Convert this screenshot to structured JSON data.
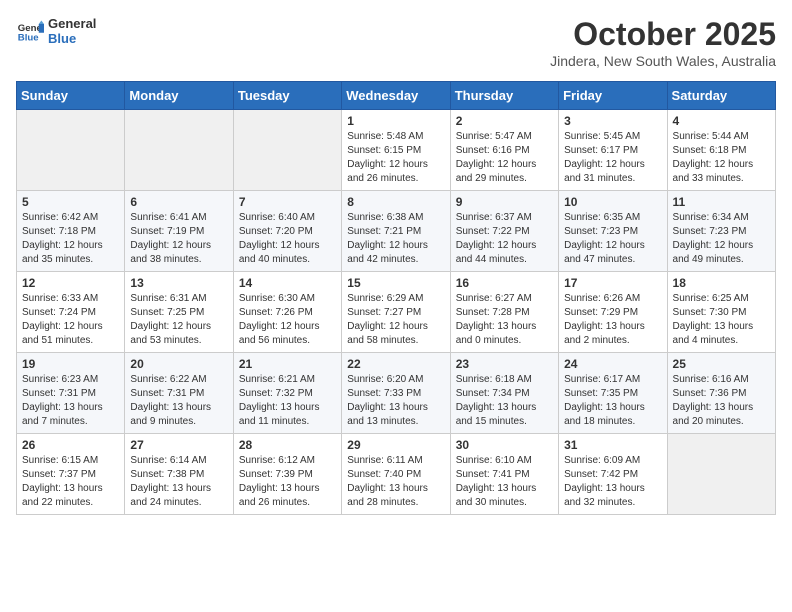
{
  "logo": {
    "line1": "General",
    "line2": "Blue"
  },
  "title": "October 2025",
  "location": "Jindera, New South Wales, Australia",
  "days_of_week": [
    "Sunday",
    "Monday",
    "Tuesday",
    "Wednesday",
    "Thursday",
    "Friday",
    "Saturday"
  ],
  "weeks": [
    [
      {
        "day": "",
        "info": ""
      },
      {
        "day": "",
        "info": ""
      },
      {
        "day": "",
        "info": ""
      },
      {
        "day": "1",
        "info": "Sunrise: 5:48 AM\nSunset: 6:15 PM\nDaylight: 12 hours\nand 26 minutes."
      },
      {
        "day": "2",
        "info": "Sunrise: 5:47 AM\nSunset: 6:16 PM\nDaylight: 12 hours\nand 29 minutes."
      },
      {
        "day": "3",
        "info": "Sunrise: 5:45 AM\nSunset: 6:17 PM\nDaylight: 12 hours\nand 31 minutes."
      },
      {
        "day": "4",
        "info": "Sunrise: 5:44 AM\nSunset: 6:18 PM\nDaylight: 12 hours\nand 33 minutes."
      }
    ],
    [
      {
        "day": "5",
        "info": "Sunrise: 6:42 AM\nSunset: 7:18 PM\nDaylight: 12 hours\nand 35 minutes."
      },
      {
        "day": "6",
        "info": "Sunrise: 6:41 AM\nSunset: 7:19 PM\nDaylight: 12 hours\nand 38 minutes."
      },
      {
        "day": "7",
        "info": "Sunrise: 6:40 AM\nSunset: 7:20 PM\nDaylight: 12 hours\nand 40 minutes."
      },
      {
        "day": "8",
        "info": "Sunrise: 6:38 AM\nSunset: 7:21 PM\nDaylight: 12 hours\nand 42 minutes."
      },
      {
        "day": "9",
        "info": "Sunrise: 6:37 AM\nSunset: 7:22 PM\nDaylight: 12 hours\nand 44 minutes."
      },
      {
        "day": "10",
        "info": "Sunrise: 6:35 AM\nSunset: 7:23 PM\nDaylight: 12 hours\nand 47 minutes."
      },
      {
        "day": "11",
        "info": "Sunrise: 6:34 AM\nSunset: 7:23 PM\nDaylight: 12 hours\nand 49 minutes."
      }
    ],
    [
      {
        "day": "12",
        "info": "Sunrise: 6:33 AM\nSunset: 7:24 PM\nDaylight: 12 hours\nand 51 minutes."
      },
      {
        "day": "13",
        "info": "Sunrise: 6:31 AM\nSunset: 7:25 PM\nDaylight: 12 hours\nand 53 minutes."
      },
      {
        "day": "14",
        "info": "Sunrise: 6:30 AM\nSunset: 7:26 PM\nDaylight: 12 hours\nand 56 minutes."
      },
      {
        "day": "15",
        "info": "Sunrise: 6:29 AM\nSunset: 7:27 PM\nDaylight: 12 hours\nand 58 minutes."
      },
      {
        "day": "16",
        "info": "Sunrise: 6:27 AM\nSunset: 7:28 PM\nDaylight: 13 hours\nand 0 minutes."
      },
      {
        "day": "17",
        "info": "Sunrise: 6:26 AM\nSunset: 7:29 PM\nDaylight: 13 hours\nand 2 minutes."
      },
      {
        "day": "18",
        "info": "Sunrise: 6:25 AM\nSunset: 7:30 PM\nDaylight: 13 hours\nand 4 minutes."
      }
    ],
    [
      {
        "day": "19",
        "info": "Sunrise: 6:23 AM\nSunset: 7:31 PM\nDaylight: 13 hours\nand 7 minutes."
      },
      {
        "day": "20",
        "info": "Sunrise: 6:22 AM\nSunset: 7:31 PM\nDaylight: 13 hours\nand 9 minutes."
      },
      {
        "day": "21",
        "info": "Sunrise: 6:21 AM\nSunset: 7:32 PM\nDaylight: 13 hours\nand 11 minutes."
      },
      {
        "day": "22",
        "info": "Sunrise: 6:20 AM\nSunset: 7:33 PM\nDaylight: 13 hours\nand 13 minutes."
      },
      {
        "day": "23",
        "info": "Sunrise: 6:18 AM\nSunset: 7:34 PM\nDaylight: 13 hours\nand 15 minutes."
      },
      {
        "day": "24",
        "info": "Sunrise: 6:17 AM\nSunset: 7:35 PM\nDaylight: 13 hours\nand 18 minutes."
      },
      {
        "day": "25",
        "info": "Sunrise: 6:16 AM\nSunset: 7:36 PM\nDaylight: 13 hours\nand 20 minutes."
      }
    ],
    [
      {
        "day": "26",
        "info": "Sunrise: 6:15 AM\nSunset: 7:37 PM\nDaylight: 13 hours\nand 22 minutes."
      },
      {
        "day": "27",
        "info": "Sunrise: 6:14 AM\nSunset: 7:38 PM\nDaylight: 13 hours\nand 24 minutes."
      },
      {
        "day": "28",
        "info": "Sunrise: 6:12 AM\nSunset: 7:39 PM\nDaylight: 13 hours\nand 26 minutes."
      },
      {
        "day": "29",
        "info": "Sunrise: 6:11 AM\nSunset: 7:40 PM\nDaylight: 13 hours\nand 28 minutes."
      },
      {
        "day": "30",
        "info": "Sunrise: 6:10 AM\nSunset: 7:41 PM\nDaylight: 13 hours\nand 30 minutes."
      },
      {
        "day": "31",
        "info": "Sunrise: 6:09 AM\nSunset: 7:42 PM\nDaylight: 13 hours\nand 32 minutes."
      },
      {
        "day": "",
        "info": ""
      }
    ]
  ]
}
